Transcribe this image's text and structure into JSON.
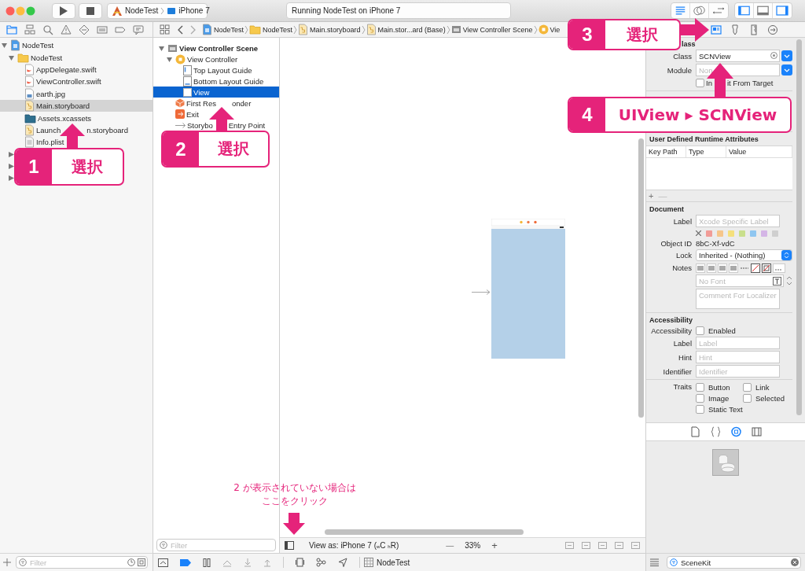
{
  "toolbar": {
    "scheme": "NodeTest",
    "device": "iPhone 7",
    "activity": "Running NodeTest on iPhone 7"
  },
  "navigator_tabs": [
    {
      "selected": true
    },
    {
      "selected": false
    },
    {
      "selected": false
    },
    {
      "selected": false
    },
    {
      "selected": false
    },
    {
      "selected": false
    },
    {
      "selected": false
    },
    {
      "selected": false
    }
  ],
  "jump_bar": [
    {
      "kind": "project",
      "label": "NodeTest"
    },
    {
      "kind": "folder",
      "label": "NodeTest"
    },
    {
      "kind": "storyboard",
      "label": "Main.storyboard"
    },
    {
      "kind": "storyboard",
      "label": "Main.stor...ard (Base)"
    },
    {
      "kind": "scene",
      "label": "View Controller Scene"
    },
    {
      "kind": "controller",
      "label": "Vie"
    }
  ],
  "inspector_tabs": [
    {
      "selected": true
    },
    {
      "selected": false
    },
    {
      "selected": false
    },
    {
      "selected": false
    }
  ],
  "navigator": {
    "items": [
      {
        "kind": "project",
        "label": "NodeTest",
        "expanded": true,
        "selected": false,
        "children": [
          {
            "kind": "folder",
            "label": "NodeTest",
            "expanded": true,
            "selected": false,
            "children": [
              {
                "kind": "swift",
                "label": "AppDelegate.swift",
                "selected": false
              },
              {
                "kind": "swift",
                "label": "ViewController.swift",
                "selected": false
              },
              {
                "kind": "image",
                "label": "earth.jpg",
                "selected": false
              },
              {
                "kind": "storyboard",
                "label": "Main.storyboard",
                "selected": true
              },
              {
                "kind": "assets",
                "label": "Assets.xcassets",
                "selected": false
              },
              {
                "kind": "storyboard",
                "label": "Launch",
                "label_tail": "n.storyboard",
                "selected": false
              },
              {
                "kind": "plist",
                "label": "Info.plist",
                "selected": false
              }
            ]
          },
          {
            "kind": "group",
            "expanded": false,
            "selected": false
          },
          {
            "kind": "group",
            "expanded": false,
            "selected": false
          },
          {
            "kind": "group",
            "expanded": false,
            "selected": false
          }
        ]
      }
    ],
    "filter_placeholder": "Filter"
  },
  "outline": {
    "items": [
      {
        "kind": "scene",
        "label": "View Controller Scene",
        "expanded": true,
        "selected": false,
        "children": [
          {
            "kind": "controller",
            "label": "View Controller",
            "expanded": true,
            "selected": false,
            "children": [
              {
                "kind": "top-guide",
                "label": "Top Layout Guide",
                "selected": false
              },
              {
                "kind": "bottom-guide",
                "label": "Bottom Layout Guide",
                "selected": false
              },
              {
                "kind": "view",
                "label": "View",
                "selected": true
              }
            ]
          },
          {
            "kind": "responder",
            "label": "First Res",
            "label_tail": "onder",
            "selected": false
          },
          {
            "kind": "exit",
            "label": "Exit",
            "selected": false
          },
          {
            "kind": "entry",
            "label": "Storybo",
            "label_tail": "Entry Point",
            "selected": false
          }
        ]
      }
    ],
    "filter_placeholder": "Filter"
  },
  "canvas": {
    "view_as": "View as: iPhone 7 ($_{w}$C $_{h}$R)",
    "zoom_out": "—",
    "zoom": "33%",
    "zoom_in": "+"
  },
  "debug_bar": {
    "process": "NodeTest"
  },
  "inspector": {
    "custom_class": {
      "title": "lass",
      "class_label": "Class",
      "class_value": "SCNView",
      "module_label": "Module",
      "module_placeholder": "Non",
      "inherit_label": "In",
      "inherit_tail": "it From Target",
      "inherit_checked": false
    },
    "runtime_attributes": {
      "title": "User Defined Runtime Attributes",
      "columns": [
        "Key Path",
        "Type",
        "Value"
      ],
      "add": "+",
      "remove": "—"
    },
    "document": {
      "title": "Document",
      "label_label": "Label",
      "label_placeholder": "Xcode Specific Label",
      "colors": [
        {
          "color": "#f19c97"
        },
        {
          "color": "#f6c68a"
        },
        {
          "color": "#f5e07c"
        },
        {
          "color": "#c9df8c"
        },
        {
          "color": "#8fc6f0"
        },
        {
          "color": "#d4b5e6"
        },
        {
          "color": "#cfcfcf"
        }
      ],
      "object_id_label": "Object ID",
      "object_id": "8bC-Xf-vdC",
      "lock_label": "Lock",
      "lock_value": "Inherited - (Nothing)",
      "notes_label": "Notes",
      "font_placeholder": "No Font",
      "comment_placeholder": "Comment For Localizer"
    },
    "accessibility": {
      "title": "Accessibility",
      "enabled_label": "Accessibility",
      "enabled_text": "Enabled",
      "enabled_checked": false,
      "fields": [
        {
          "label": "Label",
          "placeholder": "Label"
        },
        {
          "label": "Hint",
          "placeholder": "Hint"
        },
        {
          "label": "Identifier",
          "placeholder": "Identifier"
        }
      ],
      "traits_label": "Traits",
      "traits": [
        {
          "label": "Button",
          "checked": false
        },
        {
          "label": "Link",
          "checked": false
        },
        {
          "label": "Image",
          "checked": false
        },
        {
          "label": "Selected",
          "checked": false
        },
        {
          "label": "Static Text",
          "checked": false
        }
      ]
    }
  },
  "library_tabs": [
    {
      "selected": false
    },
    {
      "selected": false
    },
    {
      "selected": true
    },
    {
      "selected": false
    }
  ],
  "library_filter": "SceneKit",
  "annotations": {
    "callouts": [
      {
        "number": "1",
        "text": "選択"
      },
      {
        "number": "2",
        "text": "選択"
      },
      {
        "number": "3",
        "text": "選択"
      },
      {
        "number": "4",
        "text": "UIView ▸ SCNView"
      }
    ],
    "note": [
      "2 が表示されていない場合は",
      "ここをクリック"
    ]
  }
}
